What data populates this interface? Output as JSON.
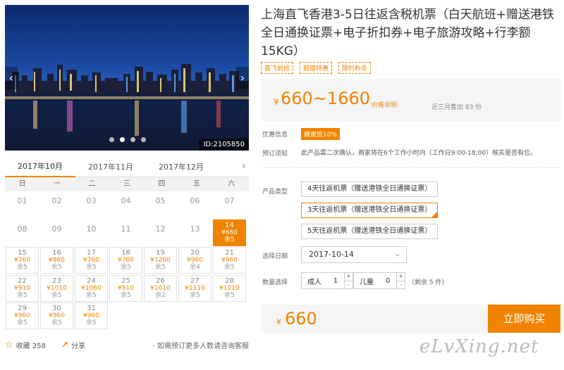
{
  "gallery": {
    "prev_icon": "‹",
    "next_icon": "›",
    "product_id": "ID:2105850",
    "dots_total": 4,
    "dot_active": 2
  },
  "calendar": {
    "months": [
      "2017年10月",
      "2017年11月",
      "2017年12月"
    ],
    "active_month": 0,
    "next_icon": "›",
    "weekdays": [
      "日",
      "一",
      "二",
      "三",
      "四",
      "五",
      "六"
    ],
    "days": [
      {
        "d": "01"
      },
      {
        "d": "02"
      },
      {
        "d": "03"
      },
      {
        "d": "04"
      },
      {
        "d": "05"
      },
      {
        "d": "06"
      },
      {
        "d": "07"
      },
      {
        "d": "08"
      },
      {
        "d": "09"
      },
      {
        "d": "10"
      },
      {
        "d": "11"
      },
      {
        "d": "12"
      },
      {
        "d": "13"
      },
      {
        "d": "14",
        "p": "¥660",
        "s": "余5",
        "selected": true
      },
      {
        "d": "15",
        "p": "¥760",
        "s": "余5"
      },
      {
        "d": "16",
        "p": "¥860",
        "s": "余5"
      },
      {
        "d": "17",
        "p": "¥760",
        "s": "余5"
      },
      {
        "d": "18",
        "p": "¥760",
        "s": "余5"
      },
      {
        "d": "19",
        "p": "¥1260",
        "s": "余5"
      },
      {
        "d": "20",
        "p": "¥960",
        "s": "余4"
      },
      {
        "d": "21",
        "p": "¥960",
        "s": "余5"
      },
      {
        "d": "22",
        "p": "¥910",
        "s": "余5"
      },
      {
        "d": "23",
        "p": "¥1010",
        "s": "余5"
      },
      {
        "d": "24",
        "p": "¥1060",
        "s": "余5"
      },
      {
        "d": "25",
        "p": "¥910",
        "s": "余5"
      },
      {
        "d": "26",
        "p": "¥1010",
        "s": "余2"
      },
      {
        "d": "27",
        "p": "¥1110",
        "s": "余5"
      },
      {
        "d": "28",
        "p": "¥1010",
        "s": "余5"
      },
      {
        "d": "29",
        "p": "¥960",
        "s": "余5"
      },
      {
        "d": "30",
        "p": "¥960",
        "s": "余5"
      },
      {
        "d": "31",
        "p": "¥960",
        "s": "余5"
      }
    ]
  },
  "footer": {
    "star_icon": "☆",
    "favorite_label": "收藏 258",
    "share_icon": "↗",
    "share_label": "分享",
    "note": "· 如需预订更多人数请咨询客服"
  },
  "product": {
    "title": "上海直飞香港3-5日往返含税机票（白天航班+赠送港铁全日通换证票+电子折扣券+电子旅游攻略+行李额15KG）",
    "tags": [
      "直飞航班",
      "超值特惠",
      "限时秒杀"
    ],
    "price_symbol": "¥",
    "price_range": "660~1660",
    "price_explain": "价格说明",
    "sold": "近三月售出 83 份"
  },
  "info": {
    "promo_label": "优惠信息",
    "promo_badge": "蜂蜜抵10%",
    "booking_label": "预订须知",
    "booking_text": "此产品需二次确认，商家将在6个工作小时内（工作日9:00-18:00）核实是否有位。"
  },
  "options": {
    "type_label": "产品类型",
    "types": [
      "4天往返机票（赠送港铁全日通换证票）",
      "3天往返机票（赠送港铁全日通换证票）",
      "5天往返机票（赠送港铁全日通换证票）"
    ],
    "selected_type": 1,
    "date_label": "选择日期",
    "date_value": "2017-10-14",
    "date_chevron": "⌄",
    "qty_label": "数量选择",
    "adult_label": "成人",
    "adult_value": "1",
    "child_label": "儿童",
    "child_value": "0",
    "plus": "+",
    "minus": "-",
    "remaining": "（剩余 5 件）"
  },
  "buy": {
    "symbol": "¥",
    "amount": "660",
    "button": "立即购买"
  },
  "watermark": "eLvXing.net",
  "colors": {
    "accent": "#f08300"
  }
}
